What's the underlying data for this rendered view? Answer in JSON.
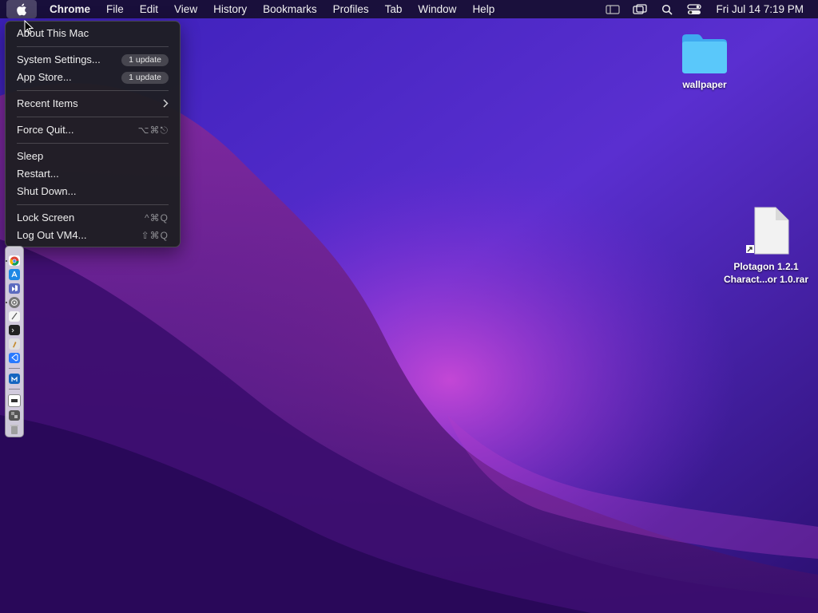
{
  "menubar": {
    "app_name": "Chrome",
    "items": [
      "File",
      "Edit",
      "View",
      "History",
      "Bookmarks",
      "Profiles",
      "Tab",
      "Window",
      "Help"
    ],
    "clock": "Fri Jul 14  7:19 PM",
    "icons": [
      "apple-logo",
      "sidebar-icon",
      "screen-mirroring-icon",
      "spotlight-search-icon",
      "control-center-icon"
    ]
  },
  "apple_menu": {
    "about": "About This Mac",
    "system_settings": "System Settings...",
    "system_settings_badge": "1 update",
    "app_store": "App Store...",
    "app_store_badge": "1 update",
    "recent_items": "Recent Items",
    "force_quit": "Force Quit...",
    "force_quit_shortcut": "⌥⌘⎋",
    "sleep": "Sleep",
    "restart": "Restart...",
    "shut_down": "Shut Down...",
    "lock_screen": "Lock Screen",
    "lock_screen_shortcut": "^⌘Q",
    "log_out": "Log Out VM4...",
    "log_out_shortcut": "⇧⌘Q"
  },
  "desktop": {
    "folder_label": "wallpaper",
    "file_label_line1": "Plotagon 1.2.1",
    "file_label_line2": "Charact...or 1.0.rar"
  },
  "colors": {
    "wallpaper_base": "#2a0f6e",
    "folder_blue": "#5ac8fa",
    "menu_bg": "#1e1e22"
  }
}
